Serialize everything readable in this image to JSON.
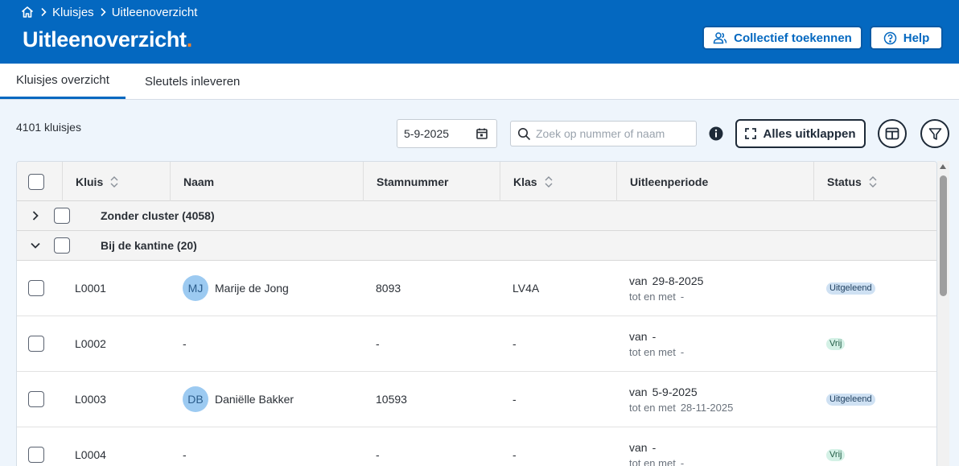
{
  "breadcrumb": {
    "items": [
      "Kluisjes",
      "Uitleenoverzicht"
    ]
  },
  "header": {
    "title": "Uitleenoverzicht",
    "title_dot": ".",
    "collect_label": "Collectief toekennen",
    "help_label": "Help"
  },
  "tabs": [
    {
      "label": "Kluisjes overzicht",
      "active": true
    },
    {
      "label": "Sleutels inleveren",
      "active": false
    }
  ],
  "toolbar": {
    "count": "4101 kluisjes",
    "date": "5-9-2025",
    "search_placeholder": "Zoek op nummer of naam",
    "expand_label": "Alles uitklappen"
  },
  "table": {
    "headers": {
      "kluis": "Kluis",
      "naam": "Naam",
      "stamnummer": "Stamnummer",
      "klas": "Klas",
      "uitleenperiode": "Uitleenperiode",
      "status": "Status"
    },
    "groups": [
      {
        "label": "Zonder cluster (4058)",
        "expanded": false
      },
      {
        "label": "Bij de kantine (20)",
        "expanded": true
      }
    ],
    "period_from_label": "van",
    "period_to_label": "tot en met",
    "rows": [
      {
        "kluis": "L0001",
        "initials": "MJ",
        "naam": "Marije de Jong",
        "stamnummer": "8093",
        "klas": "LV4A",
        "van": "29-8-2025",
        "tot": "-",
        "status": "Uitgeleend"
      },
      {
        "kluis": "L0002",
        "initials": "",
        "naam": "-",
        "stamnummer": "-",
        "klas": "-",
        "van": "-",
        "tot": "-",
        "status": "Vrij"
      },
      {
        "kluis": "L0003",
        "initials": "DB",
        "naam": "Daniëlle Bakker",
        "stamnummer": "10593",
        "klas": "-",
        "van": "5-9-2025",
        "tot": "28-11-2025",
        "status": "Uitgeleend"
      },
      {
        "kluis": "L0004",
        "initials": "",
        "naam": "-",
        "stamnummer": "-",
        "klas": "-",
        "van": "-",
        "tot": "-",
        "status": "Vrij"
      }
    ]
  },
  "colors": {
    "header_bg": "#0468c0",
    "accent_dot": "#f5822a",
    "badge_uitgeleend": "#cfe1f3",
    "badge_vrij": "#d4f1e6"
  }
}
